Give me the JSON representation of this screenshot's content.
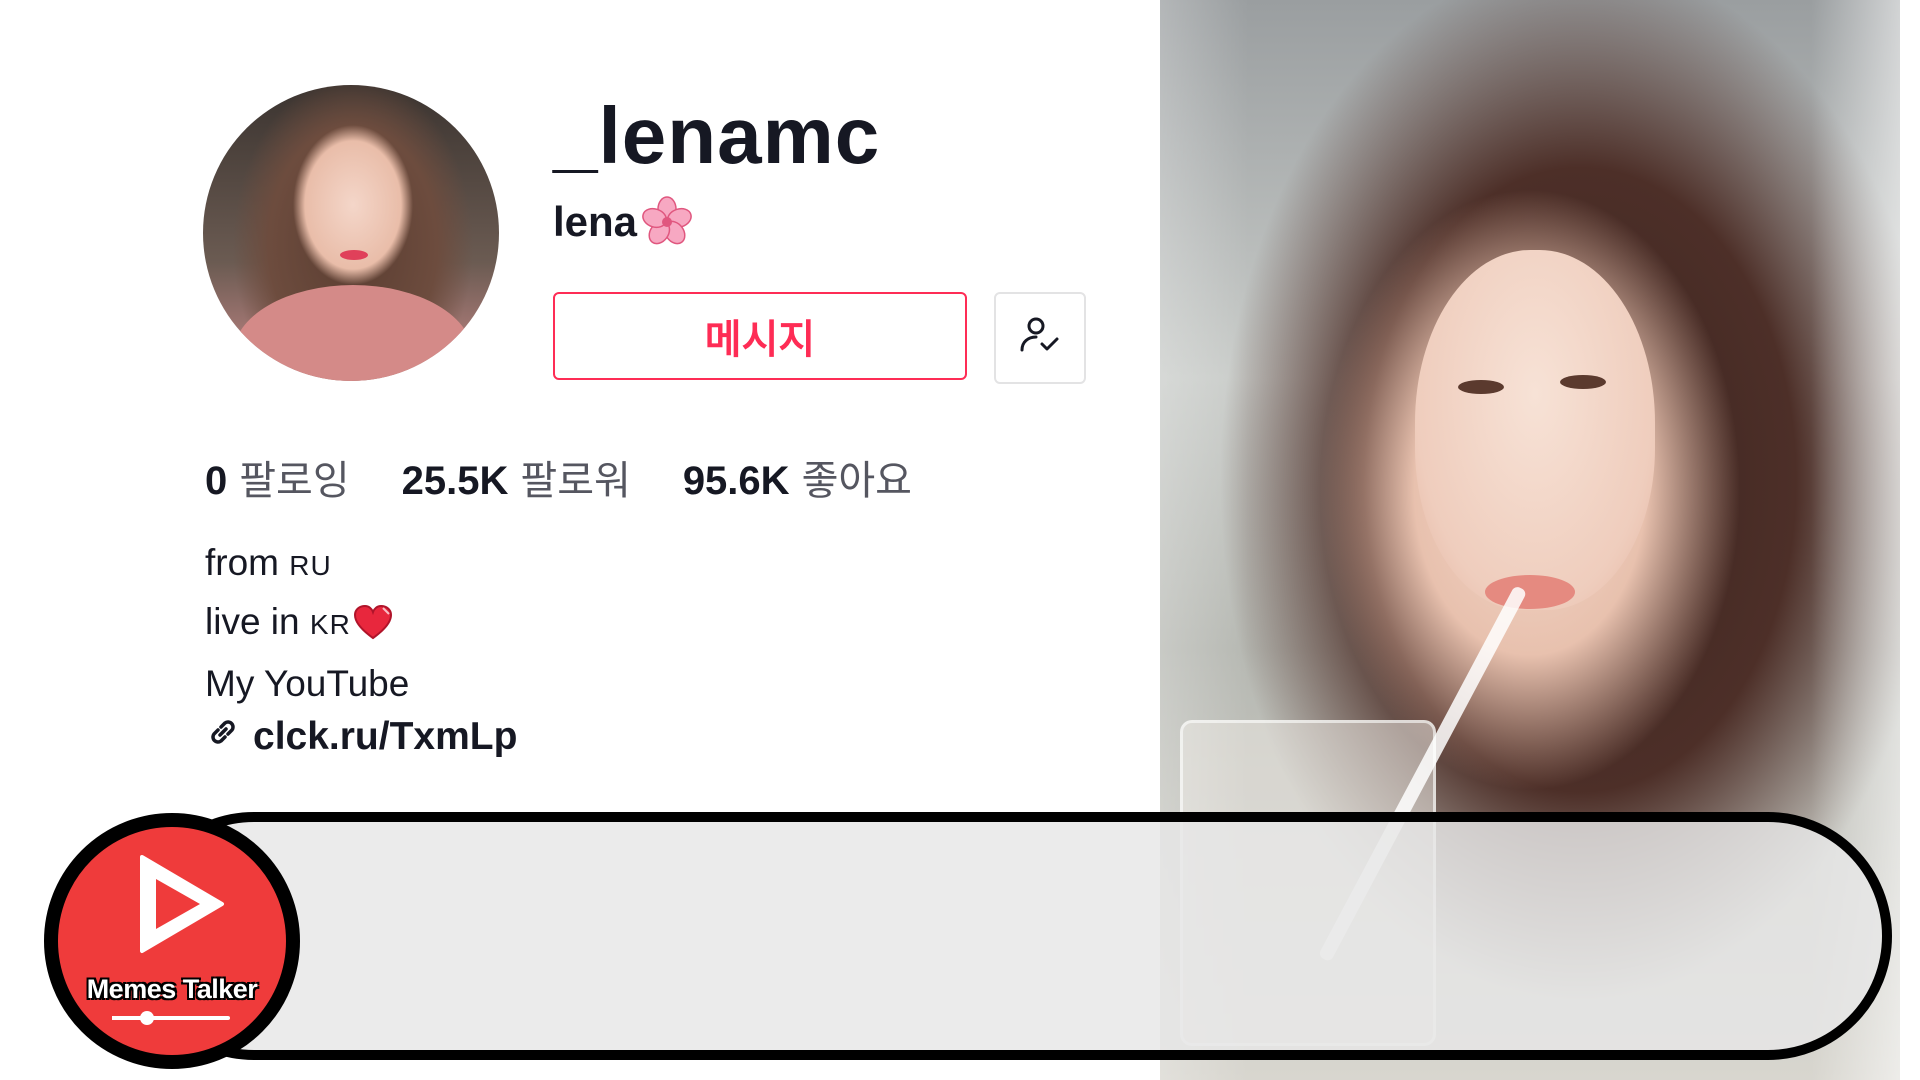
{
  "profile": {
    "username": "_lenamc",
    "nickname": "lena",
    "nickname_emoji": "cherry-blossom-icon",
    "message_button": "메시지",
    "follow_status_icon": "user-check-icon"
  },
  "stats": [
    {
      "value": "0",
      "label": "팔로잉"
    },
    {
      "value": "25.5K",
      "label": "팔로워"
    },
    {
      "value": "95.6K",
      "label": "좋아요"
    }
  ],
  "bio": {
    "line1_prefix": "from ",
    "line1_code": "RU",
    "line2_prefix": "live in ",
    "line2_code": "KR",
    "line2_emoji": "heart-icon",
    "line3": "My YouTube"
  },
  "link": {
    "icon": "link-icon",
    "text": "clck.ru/TxmLp"
  },
  "watermark": {
    "label": "Memes Talker",
    "progress": 0.3,
    "icon": "play-icon"
  },
  "colors": {
    "accent": "#fe2c55",
    "logo_red": "#ef3b3b",
    "banner_border": "#000000"
  }
}
